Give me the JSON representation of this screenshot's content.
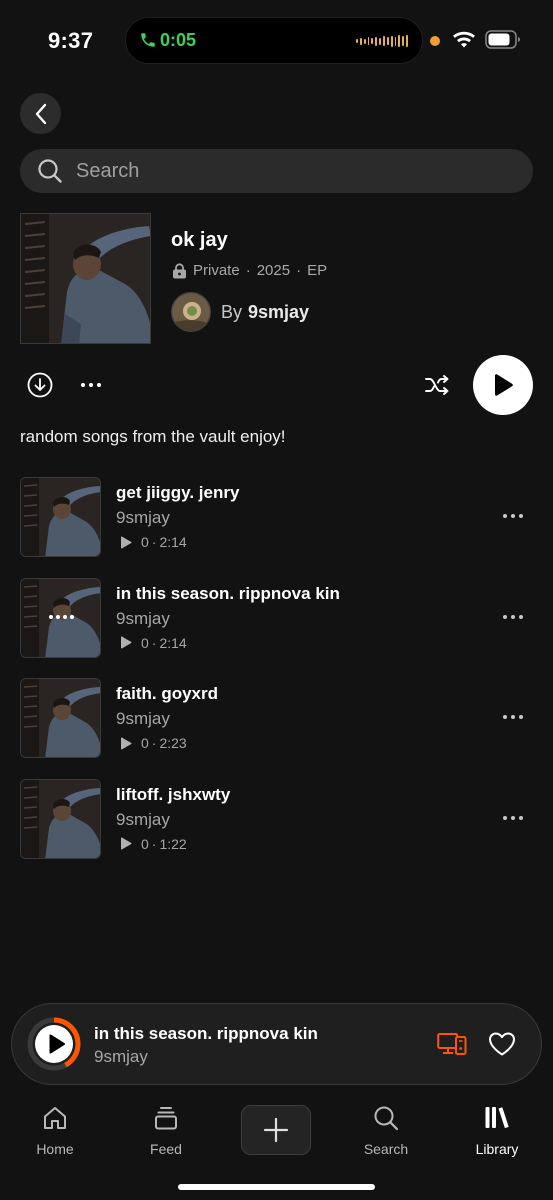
{
  "status_bar": {
    "time": "9:37",
    "call_time": "0:05",
    "icons": [
      "phone-icon",
      "audio-waveform-icon",
      "privacy-dot",
      "wifi-icon",
      "battery-icon"
    ]
  },
  "search": {
    "placeholder": "Search"
  },
  "album": {
    "title": "ok jay",
    "visibility": "Private",
    "year": "2025",
    "type": "EP",
    "by_label": "By",
    "artist": "9smjay",
    "description": "random songs from the vault enjoy!"
  },
  "tracks": [
    {
      "title": "get jiiggy. jenry",
      "artist": "9smjay",
      "plays": "0",
      "duration": "2:14",
      "now_playing": false
    },
    {
      "title": "in this season. rippnova kin",
      "artist": "9smjay",
      "plays": "0",
      "duration": "2:14",
      "now_playing": true
    },
    {
      "title": "faith. goyxrd",
      "artist": "9smjay",
      "plays": "0",
      "duration": "2:23",
      "now_playing": false
    },
    {
      "title": "liftoff. jshxwty",
      "artist": "9smjay",
      "plays": "0",
      "duration": "1:22",
      "now_playing": false
    }
  ],
  "mini_player": {
    "title": "in this season. rippnova kin",
    "artist": "9smjay",
    "progress_fraction": 0.42
  },
  "tabs": [
    {
      "label": "Home",
      "icon": "home-icon",
      "active": false
    },
    {
      "label": "Feed",
      "icon": "feed-icon",
      "active": false
    },
    {
      "label": "Search",
      "icon": "search-icon",
      "active": false
    },
    {
      "label": "Library",
      "icon": "library-icon",
      "active": true
    }
  ],
  "colors": {
    "background": "#121212",
    "accent": "#ff5500",
    "call_green": "#3ed15a",
    "muted_text": "#a6a6a6"
  }
}
